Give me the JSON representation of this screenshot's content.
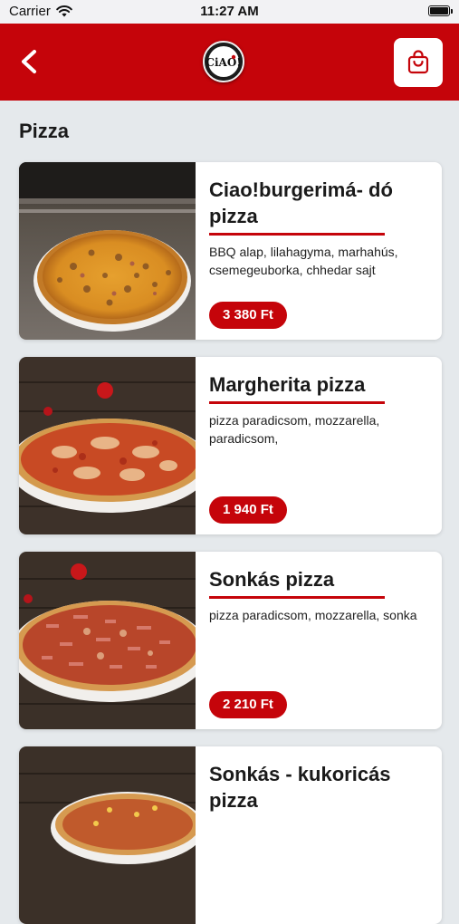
{
  "status_bar": {
    "carrier": "Carrier",
    "time": "11:27 AM"
  },
  "header": {
    "logo_text": "CiAO!",
    "back_icon": "chevron-left-icon",
    "cart_icon": "shopping-bag-icon"
  },
  "section": {
    "title": "Pizza"
  },
  "products": [
    {
      "name": "Ciao!burgerimá- dó pizza",
      "description": "BBQ alap, lilahagyma, marhahús, csemegeuborka, chhedar sajt",
      "price": "3 380 Ft"
    },
    {
      "name": "Margherita pizza",
      "description": "pizza paradicsom, mozzarella, paradicsom,",
      "price": "1 940 Ft"
    },
    {
      "name": "Sonkás pizza",
      "description": "pizza paradicsom, mozzarella, sonka",
      "price": "2 210 Ft"
    },
    {
      "name": "Sonkás - kukoricás pizza",
      "description": "",
      "price": ""
    }
  ],
  "colors": {
    "brand_red": "#c5040a",
    "background": "#e5e9ec",
    "card": "#ffffff"
  }
}
